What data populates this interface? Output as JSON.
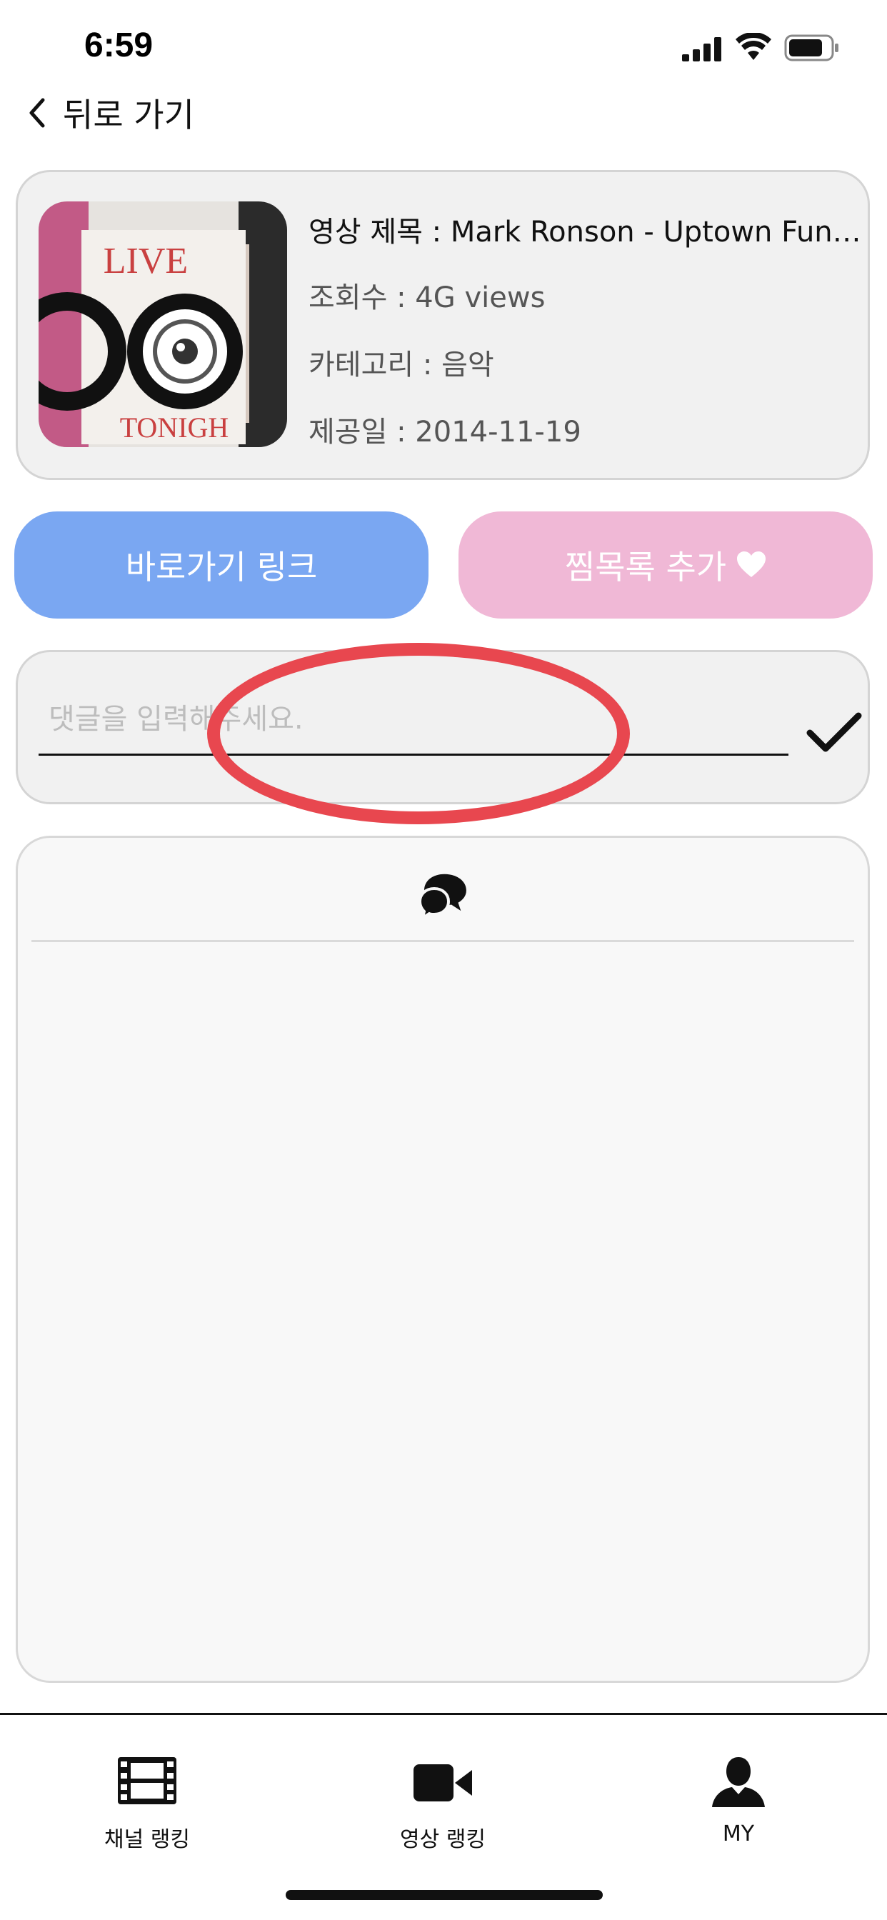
{
  "status_bar": {
    "time": "6:59"
  },
  "nav": {
    "back_label": "뒤로 가기"
  },
  "video": {
    "title": "영상 제목 : Mark Ronson - Uptown Funk...",
    "views": "조회수 : 4G views",
    "category": "카테고리 : 음악",
    "date": "제공일 : 2014-11-19",
    "thumbnail_text": {
      "top": "LIVE",
      "bottom": "TONIGH"
    }
  },
  "actions": {
    "link_label": "바로가기 링크",
    "favorite_label": "찜목록 추가"
  },
  "comment": {
    "placeholder": "댓글을 입력해주세요.",
    "value": ""
  },
  "tabs": [
    {
      "label": "채널 랭킹",
      "icon": "film-icon"
    },
    {
      "label": "영상 랭킹",
      "icon": "video-camera-icon"
    },
    {
      "label": "MY",
      "icon": "user-icon"
    }
  ],
  "colors": {
    "link_button": "#7aa7f2",
    "favorite_button": "#f0b8d6",
    "annotation": "#e8474f"
  }
}
